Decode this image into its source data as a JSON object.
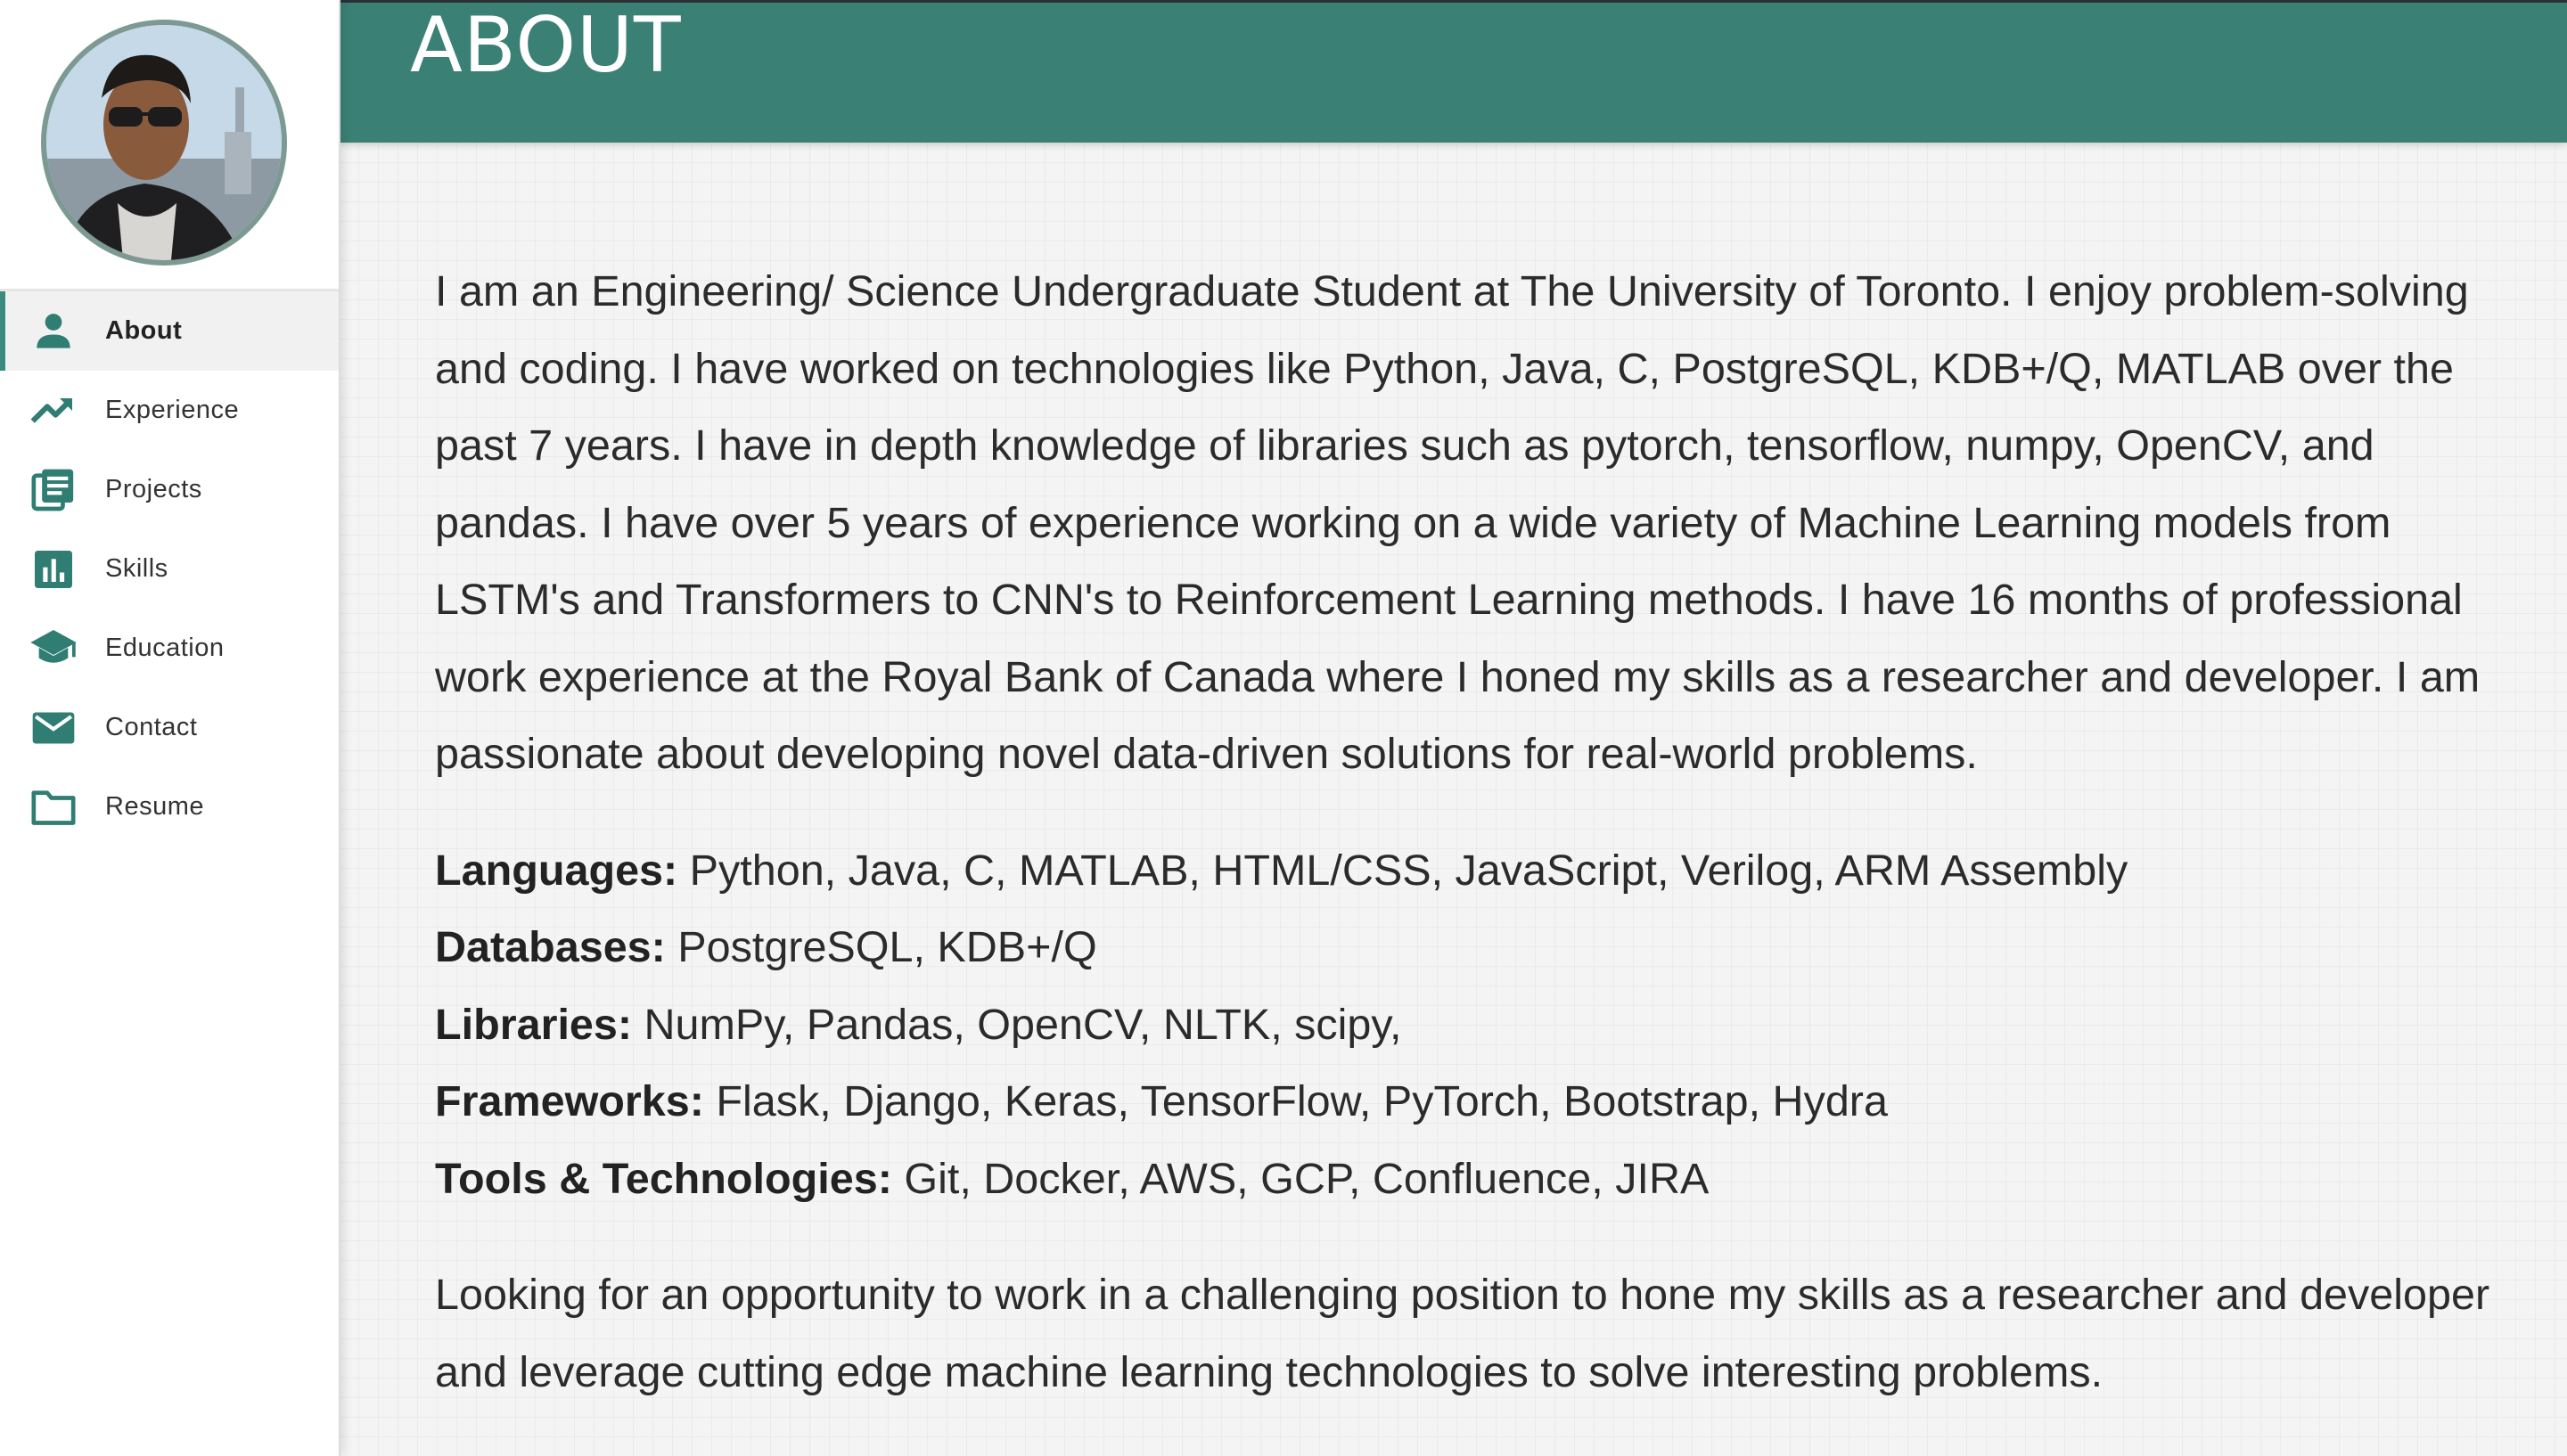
{
  "sidebar": {
    "avatar_alt": "Profile photo",
    "items": [
      {
        "label": "About",
        "icon": "person-icon",
        "active": true
      },
      {
        "label": "Experience",
        "icon": "trending-up-icon",
        "active": false
      },
      {
        "label": "Projects",
        "icon": "article-icon",
        "active": false
      },
      {
        "label": "Skills",
        "icon": "bar-chart-icon",
        "active": false
      },
      {
        "label": "Education",
        "icon": "school-icon",
        "active": false
      },
      {
        "label": "Contact",
        "icon": "mail-icon",
        "active": false
      },
      {
        "label": "Resume",
        "icon": "folder-icon",
        "active": false
      }
    ]
  },
  "header": {
    "title": "ABOUT"
  },
  "main": {
    "intro": "I am an Engineering/ Science Undergraduate Student at The University of Toronto. I enjoy problem-solving and coding. I have worked on technologies like Python, Java, C, PostgreSQL, KDB+/Q, MATLAB over the past 7 years. I have in depth knowledge of libraries such as pytorch, tensorflow, numpy, OpenCV, and pandas. I have over 5 years of experience working on a wide variety of Machine Learning models from LSTM's and Transformers to CNN's to Reinforcement Learning methods. I have 16 months of professional work experience at the Royal Bank of Canada where I honed my skills as a researcher and developer. I am passionate about developing novel data-driven solutions for real-world problems.",
    "skills": [
      {
        "label": "Languages:",
        "value": "Python, Java, C, MATLAB, HTML/CSS, JavaScript, Verilog, ARM Assembly"
      },
      {
        "label": "Databases:",
        "value": "PostgreSQL, KDB+/Q"
      },
      {
        "label": "Libraries:",
        "value": "NumPy, Pandas, OpenCV, NLTK, scipy,"
      },
      {
        "label": "Frameworks:",
        "value": "Flask, Django, Keras, TensorFlow, PyTorch, Bootstrap, Hydra"
      },
      {
        "label": "Tools & Technologies:",
        "value": "Git, Docker, AWS, GCP, Confluence, JIRA"
      }
    ],
    "outro": "Looking for an opportunity to work in a challenging position to hone my skills as a researcher and developer and leverage cutting edge machine learning technologies to solve interesting problems."
  },
  "colors": {
    "accent": "#3a8074",
    "icon": "#2f7d73",
    "text": "#2b2b2b"
  }
}
